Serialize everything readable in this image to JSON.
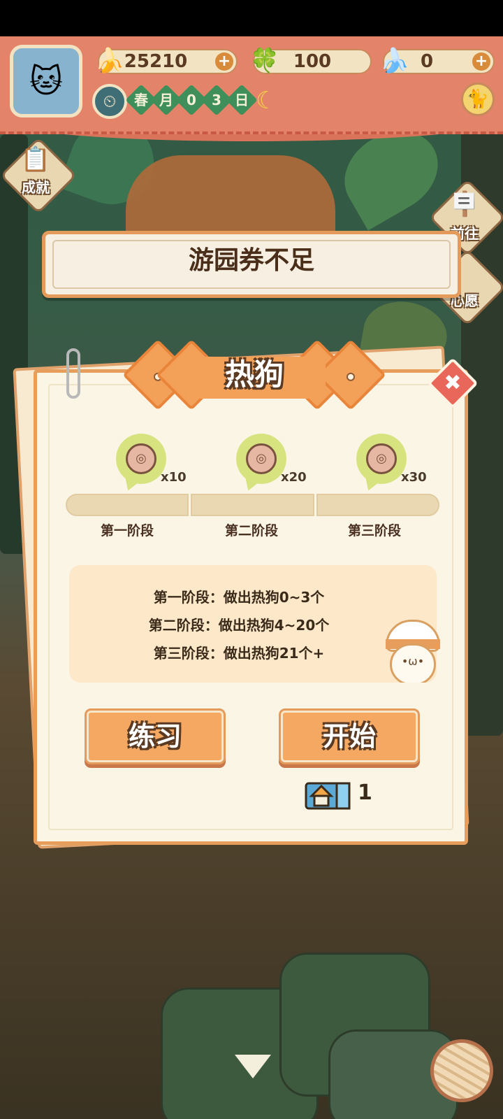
{
  "header": {
    "currencies": [
      {
        "icon": "banana-icon",
        "glyph": "🍌",
        "value": "25210",
        "has_plus": true
      },
      {
        "icon": "clover-icon",
        "glyph": "🍀",
        "value": "100",
        "has_plus": false
      },
      {
        "icon": "blue-banana-icon",
        "glyph": "🍌",
        "value": "0",
        "has_plus": true
      }
    ],
    "date": [
      "春",
      "月",
      "0",
      "3",
      "日"
    ]
  },
  "sidebar": {
    "achievements_label": "成就",
    "goto_label": "前往",
    "wish_label": "心愿"
  },
  "toast": {
    "text": "游园券不足"
  },
  "dialog": {
    "title": "热狗",
    "close_glyph": "✖",
    "rewards": [
      {
        "qty": "x10"
      },
      {
        "qty": "x20"
      },
      {
        "qty": "x30"
      }
    ],
    "stages": [
      "第一阶段",
      "第二阶段",
      "第三阶段"
    ],
    "info_lines": [
      "第一阶段：做出热狗0~3个",
      "第二阶段：做出热狗4~20个",
      "第三阶段：做出热狗21个+"
    ],
    "practice_label": "练习",
    "start_label": "开始",
    "ticket_count": "1"
  },
  "colors": {
    "accent_orange": "#f5a862",
    "header_red": "#e3846a",
    "panel_cream": "#fbf5e6"
  }
}
